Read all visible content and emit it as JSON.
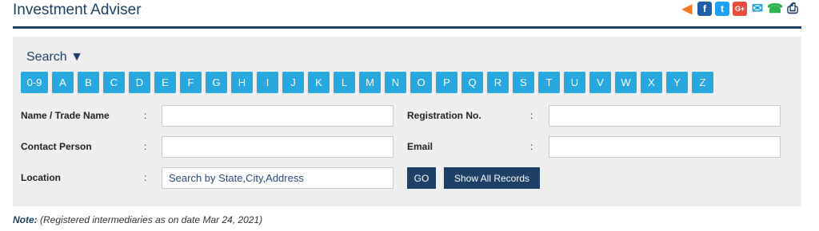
{
  "header": {
    "title": "Investment Adviser"
  },
  "share_icons": [
    {
      "name": "share-icon",
      "glyph": "<",
      "color": "#f47c20"
    },
    {
      "name": "facebook-icon",
      "glyph": "f",
      "color": "#1e5fa8"
    },
    {
      "name": "twitter-icon",
      "glyph": "t",
      "color": "#1da1f2"
    },
    {
      "name": "google-plus-icon",
      "glyph": "G+",
      "color": "#e94b3c"
    },
    {
      "name": "email-icon",
      "glyph": "✉",
      "color": "#1aa1dc"
    },
    {
      "name": "whatsapp-icon",
      "glyph": "◎",
      "color": "#2ab14b"
    },
    {
      "name": "print-icon",
      "glyph": "⎙",
      "color": "#1e3f66"
    }
  ],
  "search": {
    "toggle_label": "Search ▼",
    "letters": [
      "0-9",
      "A",
      "B",
      "C",
      "D",
      "E",
      "F",
      "G",
      "H",
      "I",
      "J",
      "K",
      "L",
      "M",
      "N",
      "O",
      "P",
      "Q",
      "R",
      "S",
      "T",
      "U",
      "V",
      "W",
      "X",
      "Y",
      "Z"
    ],
    "name_label": "Name / Trade Name",
    "reg_label": "Registration No.",
    "contact_label": "Contact Person",
    "email_label": "Email",
    "location_label": "Location",
    "colon": ":",
    "location_placeholder": "Search by State,City,Address",
    "go_label": "GO",
    "show_all_label": "Show All Records"
  },
  "note": {
    "label": "Note:",
    "text": " (Registered intermediaries as on date Mar 24, 2021)"
  }
}
